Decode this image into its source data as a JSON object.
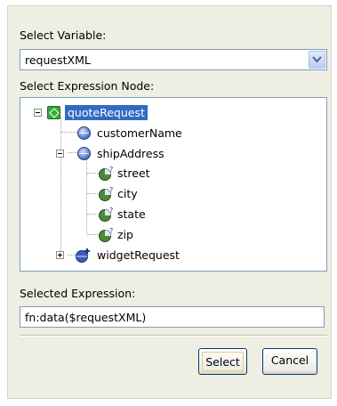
{
  "select_variable": {
    "label": "Select Variable:",
    "value": "requestXML"
  },
  "expression_node": {
    "label": "Select Expression Node:",
    "tree": {
      "root": "quoteRequest",
      "children": [
        "customerName",
        "shipAddress",
        "widgetRequest"
      ],
      "shipAddress_children": [
        "street",
        "city",
        "state",
        "zip"
      ]
    }
  },
  "selected_expression": {
    "label": "Selected Expression:",
    "value": "fn:data($requestXML)"
  },
  "buttons": {
    "select": "Select",
    "cancel": "Cancel"
  },
  "icons": {
    "root": "element-root-icon",
    "element": "element-node-icon",
    "attribute": "attribute-icon",
    "expand": "expand-plus-icon",
    "collapse": "collapse-minus-icon",
    "dropdown": "chevron-down-icon"
  }
}
